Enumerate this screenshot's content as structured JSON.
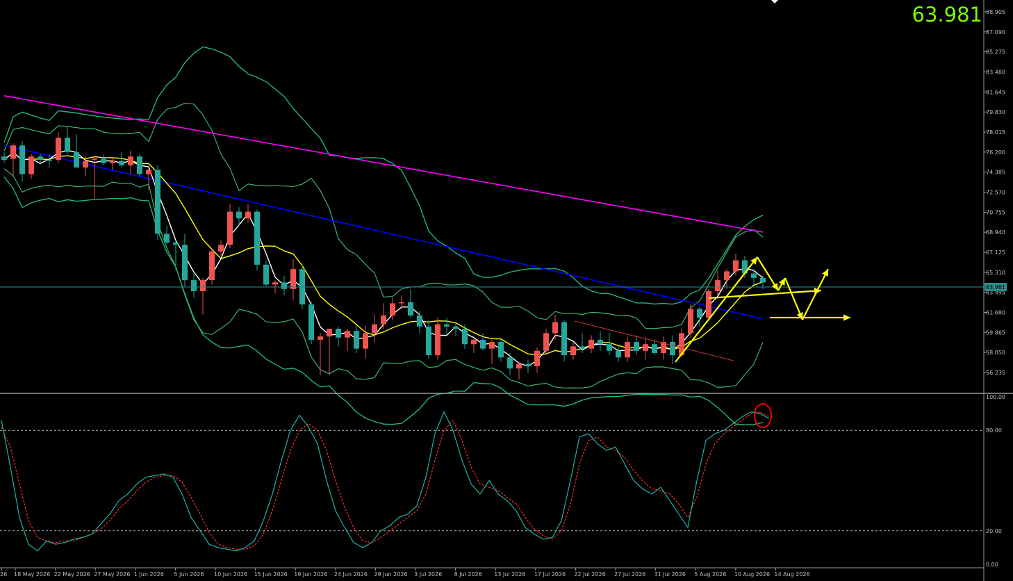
{
  "header": {
    "current_price": "63.981",
    "price_label": "63.981"
  },
  "colors": {
    "background": "#000000",
    "bull_candle": "#ef5350",
    "bear_candle": "#26a69a",
    "bollinger_outer": "#22b573",
    "bollinger_inner": "#3cb371",
    "ma_fast": "#ffffff",
    "ma_mid": "#ffff00",
    "ma_slow": "#0000ff",
    "ma_long": "#ff00ff",
    "stoch_main": "#20b2aa",
    "stoch_signal": "#ff3030",
    "drawing": "#ffff00",
    "highlight_circle": "#ff0000",
    "axis_text": "#c0c0c0"
  },
  "chart_data": [
    {
      "type": "candlestick",
      "name": "price",
      "ylim": [
        55.0,
        89.5
      ],
      "y_ticks": [
        "88.905",
        "87.090",
        "85.275",
        "83.460",
        "81.645",
        "79.830",
        "78.015",
        "76.200",
        "74.385",
        "72.570",
        "70.755",
        "68.940",
        "67.125",
        "65.310",
        "63.495",
        "61.680",
        "59.865",
        "58.050",
        "56.235"
      ],
      "x_labels": [
        "26",
        "18 May 2026",
        "22 May 2026",
        "27 May 2026",
        "1 Jun 2026",
        "5 Jun 2026",
        "10 Jun 2026",
        "15 Jun 2026",
        "19 Jun 2026",
        "24 Jun 2026",
        "29 Jun 2026",
        "3 Jul 2026",
        "8 Jul 2026",
        "13 Jul 2026",
        "17 Jul 2026",
        "22 Jul 2026",
        "27 Jul 2026",
        "31 Jul 2026",
        "5 Aug 2026",
        "10 Aug 2026",
        "14 Aug 2026"
      ],
      "current_price": 63.981,
      "candles": [
        [
          75.8,
          76.2,
          75.2,
          75.5
        ],
        [
          75.6,
          77.0,
          74.0,
          76.8
        ],
        [
          76.8,
          77.2,
          73.5,
          74.2
        ],
        [
          74.2,
          76.0,
          73.8,
          75.8
        ],
        [
          75.8,
          76.0,
          75.2,
          75.5
        ],
        [
          75.5,
          76.0,
          74.8,
          75.4
        ],
        [
          75.5,
          78.0,
          75.2,
          77.5
        ],
        [
          77.5,
          78.5,
          76.0,
          76.2
        ],
        [
          76.2,
          77.8,
          75.0,
          74.8
        ],
        [
          74.8,
          75.8,
          74.0,
          75.4
        ],
        [
          75.5,
          75.8,
          72.0,
          75.6
        ],
        [
          75.6,
          76.0,
          75.0,
          75.2
        ],
        [
          75.2,
          75.8,
          74.6,
          75.4
        ],
        [
          75.4,
          76.2,
          74.8,
          75.0
        ],
        [
          75.0,
          76.3,
          74.2,
          75.8
        ],
        [
          75.8,
          76.0,
          74.0,
          74.2
        ],
        [
          74.2,
          74.8,
          72.8,
          74.6
        ],
        [
          74.6,
          75.0,
          68.2,
          68.8
        ],
        [
          68.8,
          69.5,
          67.8,
          68.0
        ],
        [
          68.0,
          68.2,
          65.5,
          67.8
        ],
        [
          67.8,
          68.8,
          64.0,
          64.6
        ],
        [
          64.6,
          65.2,
          63.0,
          63.6
        ],
        [
          63.6,
          64.8,
          61.5,
          64.6
        ],
        [
          64.6,
          67.5,
          64.2,
          67.2
        ],
        [
          67.2,
          68.2,
          66.8,
          67.8
        ],
        [
          67.8,
          71.5,
          67.5,
          70.8
        ],
        [
          70.8,
          71.2,
          69.5,
          70.2
        ],
        [
          70.2,
          71.5,
          69.8,
          70.8
        ],
        [
          70.8,
          71.0,
          65.5,
          66.0
        ],
        [
          66.0,
          66.4,
          64.0,
          64.2
        ],
        [
          64.2,
          64.6,
          63.4,
          64.4
        ],
        [
          64.4,
          65.0,
          63.2,
          63.8
        ],
        [
          63.8,
          66.5,
          62.8,
          65.6
        ],
        [
          65.6,
          66.0,
          62.0,
          62.4
        ],
        [
          62.4,
          62.6,
          58.8,
          59.2
        ],
        [
          59.2,
          59.8,
          56.0,
          59.5
        ],
        [
          59.5,
          59.8,
          56.0,
          60.2
        ],
        [
          60.2,
          60.4,
          58.6,
          59.4
        ],
        [
          59.4,
          60.2,
          58.2,
          60.0
        ],
        [
          60.0,
          60.5,
          58.0,
          58.4
        ],
        [
          58.4,
          60.5,
          57.5,
          59.8
        ],
        [
          59.8,
          61.5,
          59.0,
          60.6
        ],
        [
          60.6,
          62.5,
          60.2,
          61.4
        ],
        [
          61.4,
          63.0,
          61.0,
          62.5
        ],
        [
          62.5,
          63.2,
          62.0,
          62.6
        ],
        [
          62.6,
          63.8,
          61.2,
          61.4
        ],
        [
          61.4,
          61.8,
          59.8,
          60.4
        ],
        [
          60.4,
          61.0,
          57.5,
          57.8
        ],
        [
          57.8,
          61.2,
          57.4,
          60.6
        ],
        [
          60.6,
          61.2,
          59.6,
          60.4
        ],
        [
          60.4,
          60.8,
          59.5,
          60.2
        ],
        [
          60.2,
          60.6,
          58.4,
          58.8
        ],
        [
          58.8,
          59.4,
          58.0,
          59.2
        ],
        [
          59.2,
          59.8,
          58.2,
          58.4
        ],
        [
          58.4,
          59.2,
          57.0,
          59.0
        ],
        [
          59.0,
          59.4,
          57.2,
          57.6
        ],
        [
          57.6,
          58.0,
          56.0,
          56.6
        ],
        [
          56.6,
          57.2,
          55.6,
          57.0
        ],
        [
          57.0,
          57.4,
          56.2,
          56.8
        ],
        [
          56.8,
          58.5,
          56.2,
          58.2
        ],
        [
          58.2,
          60.2,
          57.8,
          59.8
        ],
        [
          59.8,
          61.5,
          59.2,
          60.8
        ],
        [
          60.8,
          61.0,
          57.2,
          57.8
        ],
        [
          57.8,
          59.0,
          57.4,
          58.6
        ],
        [
          58.6,
          59.8,
          58.0,
          58.4
        ],
        [
          58.4,
          59.6,
          58.0,
          59.2
        ],
        [
          59.2,
          60.0,
          58.2,
          58.8
        ],
        [
          58.8,
          59.8,
          57.8,
          58.2
        ],
        [
          58.2,
          58.6,
          57.2,
          57.6
        ],
        [
          57.6,
          59.5,
          57.2,
          59.0
        ],
        [
          59.0,
          59.6,
          57.8,
          58.2
        ],
        [
          58.2,
          59.4,
          57.4,
          58.8
        ],
        [
          58.8,
          59.2,
          57.8,
          58.0
        ],
        [
          58.0,
          59.5,
          57.4,
          59.0
        ],
        [
          59.0,
          59.6,
          57.0,
          57.8
        ],
        [
          57.8,
          60.2,
          57.6,
          59.8
        ],
        [
          59.8,
          62.4,
          59.4,
          62.0
        ],
        [
          62.0,
          62.2,
          60.4,
          61.2
        ],
        [
          61.2,
          63.8,
          61.0,
          63.6
        ],
        [
          63.6,
          65.5,
          63.2,
          64.6
        ],
        [
          64.6,
          65.6,
          63.8,
          65.4
        ],
        [
          65.4,
          67.0,
          65.0,
          66.4
        ],
        [
          66.4,
          66.8,
          64.8,
          65.2
        ],
        [
          65.2,
          65.6,
          64.2,
          64.8
        ],
        [
          64.8,
          65.0,
          63.8,
          64.4
        ]
      ]
    },
    {
      "type": "line",
      "name": "stochastic",
      "ylim": [
        0,
        100
      ],
      "y_ticks": [
        "100.00",
        "80.00",
        "20.00",
        "0.00"
      ],
      "levels": [
        80,
        20
      ],
      "series_main": [
        86,
        58,
        28,
        12,
        8,
        14,
        12,
        13,
        15,
        16,
        18,
        24,
        30,
        38,
        42,
        48,
        52,
        53,
        54,
        52,
        42,
        28,
        20,
        12,
        10,
        9,
        8,
        10,
        14,
        26,
        42,
        62,
        80,
        89,
        82,
        72,
        50,
        32,
        22,
        13,
        10,
        13,
        20,
        23,
        28,
        30,
        35,
        52,
        78,
        91,
        80,
        62,
        48,
        42,
        50,
        42,
        38,
        32,
        22,
        18,
        15,
        16,
        26,
        50,
        76,
        78,
        72,
        68,
        70,
        60,
        50,
        45,
        42,
        46,
        38,
        30,
        22,
        50,
        74,
        78,
        80,
        84,
        88,
        91,
        90,
        87
      ],
      "series_signal": [
        82,
        70,
        48,
        26,
        16,
        14,
        13,
        14,
        14,
        16,
        18,
        21,
        26,
        33,
        38,
        44,
        49,
        52,
        53,
        53,
        49,
        40,
        30,
        19,
        12,
        10,
        9,
        9,
        11,
        18,
        32,
        50,
        68,
        80,
        84,
        80,
        68,
        50,
        34,
        22,
        14,
        13,
        16,
        20,
        24,
        28,
        32,
        42,
        62,
        80,
        86,
        74,
        58,
        48,
        46,
        44,
        40,
        36,
        28,
        21,
        17,
        15,
        20,
        36,
        60,
        74,
        76,
        70,
        68,
        64,
        56,
        50,
        45,
        44,
        42,
        36,
        28,
        40,
        60,
        72,
        78,
        82,
        86,
        90,
        91,
        88
      ]
    }
  ]
}
